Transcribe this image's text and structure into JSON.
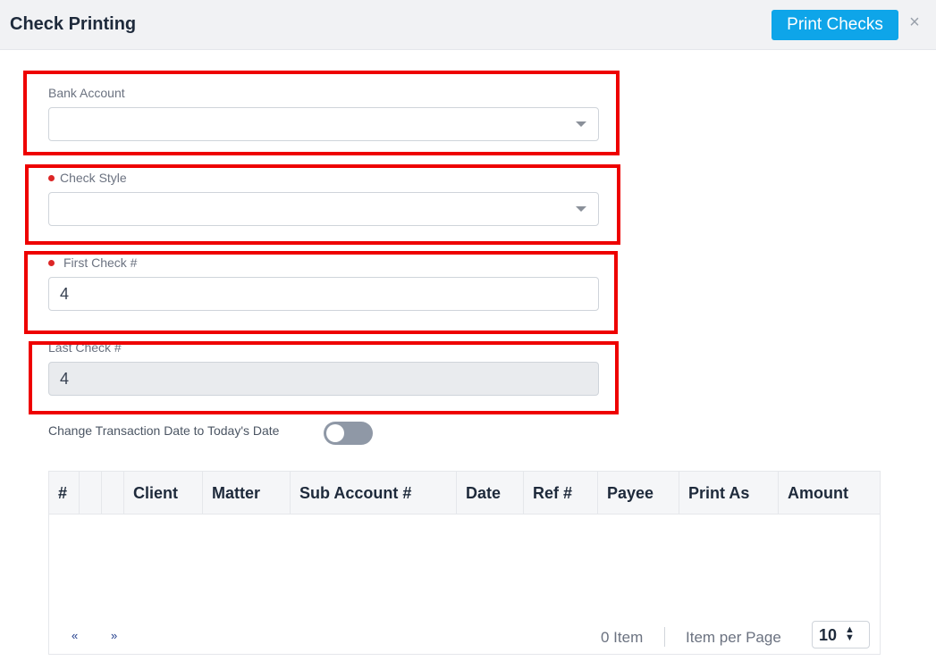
{
  "dialog": {
    "title": "Check Printing",
    "print_button": "Print Checks",
    "close_glyph": "×"
  },
  "form": {
    "bank_account": {
      "label": "Bank Account",
      "value": ""
    },
    "check_style": {
      "label": "Check Style",
      "value": "",
      "required": true
    },
    "first_check": {
      "label": "First Check #",
      "value": "4",
      "required": true
    },
    "last_check": {
      "label": "Last Check #",
      "value": "4",
      "disabled": true
    },
    "change_date": {
      "label": "Change Transaction Date to Today's Date",
      "enabled": false
    }
  },
  "table": {
    "columns": [
      "#",
      "",
      "",
      "Client",
      "Matter",
      "Sub Account #",
      "Date",
      "Ref #",
      "Payee",
      "Print As",
      "Amount"
    ],
    "rows": []
  },
  "pager": {
    "prev": "«",
    "next": "»",
    "item_count": "0 Item",
    "per_page_label": "Item per Page",
    "per_page_value": "10"
  },
  "colors": {
    "accent": "#0ea5e9",
    "highlight_border": "#ee0000",
    "required_dot": "#dc2626"
  }
}
